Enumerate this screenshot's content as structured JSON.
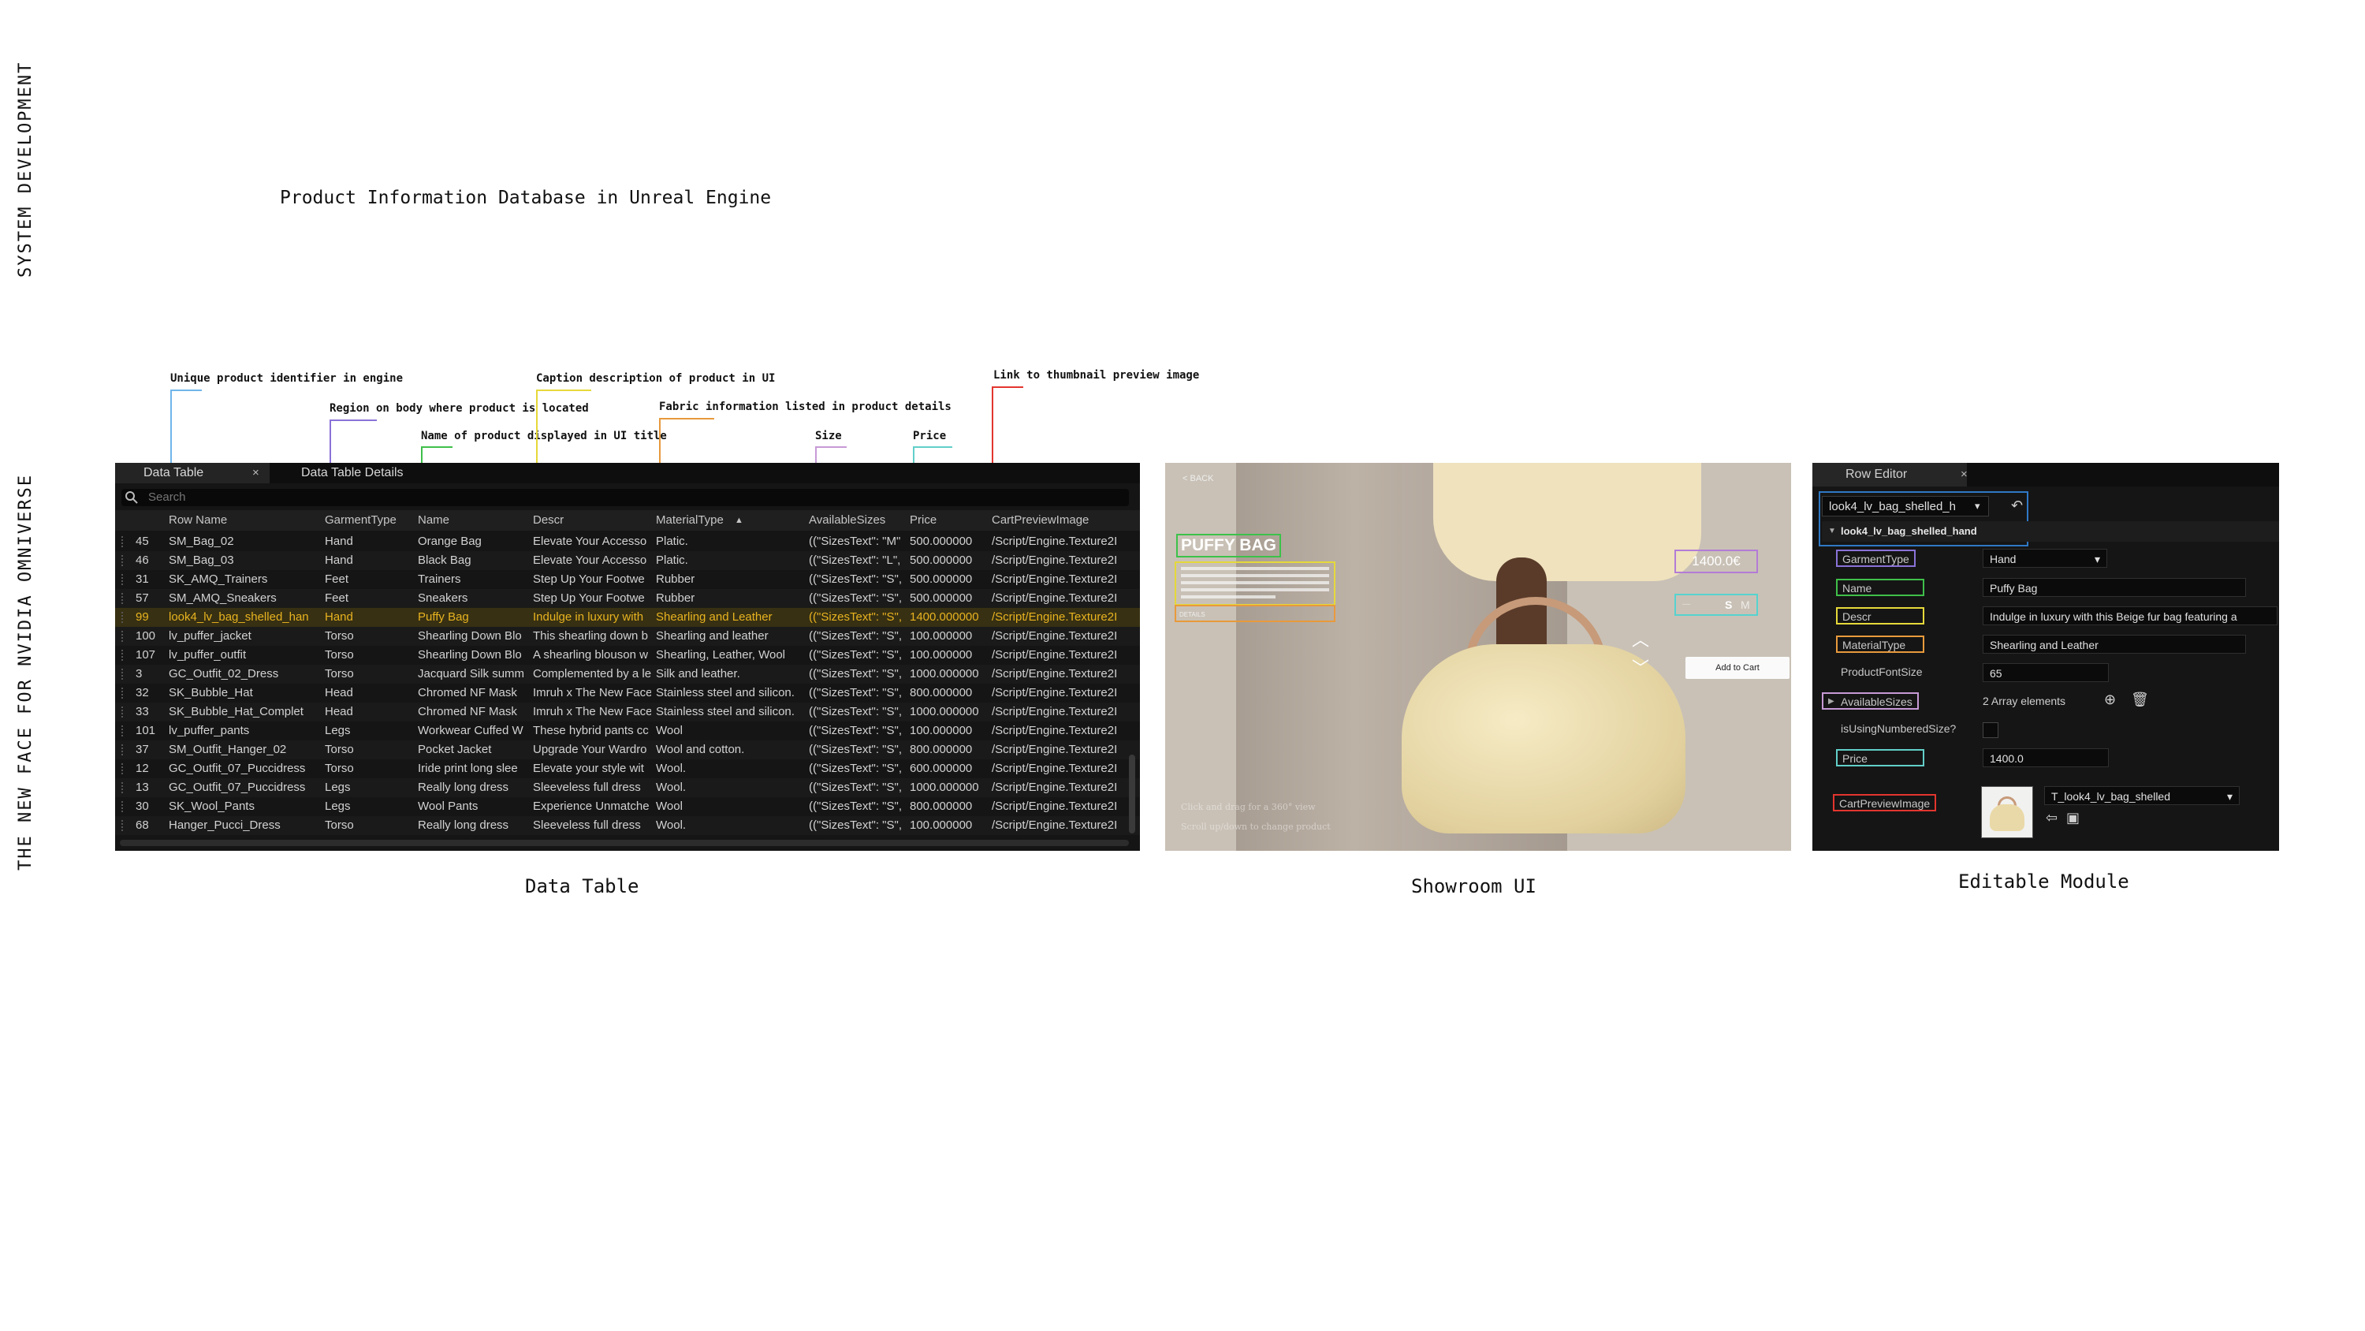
{
  "side_labels": {
    "top": "SYSTEM DEVELOPMENT",
    "bottom": "THE NEW FACE FOR NVIDIA OMNIVERSE"
  },
  "page_title": "Product Information Database in Unreal Engine",
  "colors": {
    "row_name": "#6fb5ea",
    "garment_type": "#8a72d8",
    "name": "#3fbf4a",
    "descr": "#e6d93a",
    "material": "#e89a3c",
    "sizes": "#c79ad6",
    "price": "#62cfc9",
    "cart_preview": "#e2352e",
    "selection": "#e8b320",
    "editor_highlight": "#2f78c4"
  },
  "annotations": {
    "row_name": "Unique product identifier in engine",
    "garment_type": "Region on body where product is located",
    "name": "Name of product displayed in UI title",
    "descr": "Caption description of product in UI",
    "material": "Fabric information listed in product details",
    "sizes": "Size",
    "price": "Price",
    "cart_preview": "Link to thumbnail preview image"
  },
  "data_table": {
    "tab_active": "Data Table",
    "tab_details": "Data Table Details",
    "close_glyph": "×",
    "search_placeholder": "Search",
    "sort_indicator": "▲",
    "columns": [
      "Row Name",
      "GarmentType",
      "Name",
      "Descr",
      "MaterialType",
      "AvailableSizes",
      "Price",
      "CartPreviewImage"
    ],
    "rows": [
      [
        "45",
        "SM_Bag_02",
        "Hand",
        "Orange Bag",
        "Elevate Your Accesso",
        "Platic.",
        "((\"SizesText\": \"M\"",
        "500.000000",
        "/Script/Engine.Texture2I"
      ],
      [
        "46",
        "SM_Bag_03",
        "Hand",
        "Black Bag",
        "Elevate Your Accesso",
        "Platic.",
        "((\"SizesText\": \"L\",",
        "500.000000",
        "/Script/Engine.Texture2I"
      ],
      [
        "31",
        "SK_AMQ_Trainers",
        "Feet",
        "Trainers",
        "Step Up Your Footwe",
        "Rubber",
        "((\"SizesText\": \"S\",",
        "500.000000",
        "/Script/Engine.Texture2I"
      ],
      [
        "57",
        "SM_AMQ_Sneakers",
        "Feet",
        "Sneakers",
        "Step Up Your Footwe",
        "Rubber",
        "((\"SizesText\": \"S\",",
        "500.000000",
        "/Script/Engine.Texture2I"
      ],
      [
        "99",
        "look4_lv_bag_shelled_han",
        "Hand",
        "Puffy Bag",
        "Indulge in luxury with",
        "Shearling and Leather",
        "((\"SizesText\": \"S\",",
        "1400.000000",
        "/Script/Engine.Texture2I"
      ],
      [
        "100",
        "lv_puffer_jacket",
        "Torso",
        "Shearling Down Blo",
        "This shearling down b",
        "Shearling and leather",
        "((\"SizesText\": \"S\",",
        "100.000000",
        "/Script/Engine.Texture2I"
      ],
      [
        "107",
        "lv_puffer_outfit",
        "Torso",
        "Shearling Down Blo",
        "A shearling blouson w",
        "Shearling, Leather, Wool",
        "((\"SizesText\": \"S\",",
        "100.000000",
        "/Script/Engine.Texture2I"
      ],
      [
        "3",
        "GC_Outfit_02_Dress",
        "Torso",
        "Jacquard Silk summ",
        "Complemented by a le",
        "Silk and leather.",
        "((\"SizesText\": \"S\",",
        "1000.000000",
        "/Script/Engine.Texture2I"
      ],
      [
        "32",
        "SK_Bubble_Hat",
        "Head",
        "Chromed NF Mask",
        "Imruh x The New Face",
        "Stainless steel and silicon.",
        "((\"SizesText\": \"S\",",
        "800.000000",
        "/Script/Engine.Texture2I"
      ],
      [
        "33",
        "SK_Bubble_Hat_Complet",
        "Head",
        "Chromed NF Mask",
        "Imruh x The New Face",
        "Stainless steel and silicon.",
        "((\"SizesText\": \"S\",",
        "1000.000000",
        "/Script/Engine.Texture2I"
      ],
      [
        "101",
        "lv_puffer_pants",
        "Legs",
        "Workwear Cuffed W",
        "These hybrid pants cc",
        "Wool",
        "((\"SizesText\": \"S\",",
        "100.000000",
        "/Script/Engine.Texture2I"
      ],
      [
        "37",
        "SM_Outfit_Hanger_02",
        "Torso",
        "Pocket Jacket",
        "Upgrade Your Wardro",
        "Wool and cotton.",
        "((\"SizesText\": \"S\",",
        "800.000000",
        "/Script/Engine.Texture2I"
      ],
      [
        "12",
        "GC_Outfit_07_Puccidress",
        "Torso",
        "Iride print long slee",
        "Elevate your style wit",
        "Wool.",
        "((\"SizesText\": \"S\",",
        "600.000000",
        "/Script/Engine.Texture2I"
      ],
      [
        "13",
        "GC_Outfit_07_Puccidress",
        "Legs",
        "Really long dress",
        "Sleeveless full dress",
        "Wool.",
        "((\"SizesText\": \"S\",",
        "1000.000000",
        "/Script/Engine.Texture2I"
      ],
      [
        "30",
        "SK_Wool_Pants",
        "Legs",
        "Wool Pants",
        "Experience Unmatche",
        "Wool",
        "((\"SizesText\": \"S\",",
        "800.000000",
        "/Script/Engine.Texture2I"
      ],
      [
        "68",
        "Hanger_Pucci_Dress",
        "Torso",
        "Really long dress",
        "Sleeveless full dress",
        "Wool.",
        "((\"SizesText\": \"S\",",
        "100.000000",
        "/Script/Engine.Texture2I"
      ]
    ],
    "selected_row_index": 4,
    "caption": "Data Table"
  },
  "showroom": {
    "back": "< BACK",
    "title": "PUFFY BAG",
    "details_label": "DETAILS",
    "price": "1400.0€",
    "size_selected": "S",
    "size_next": "M",
    "add_to_cart": "Add to Cart",
    "up_glyph": "︿",
    "down_glyph": "﹀",
    "hint1": "Click and drag for a 360° view",
    "hint2": "Scroll up/down to change product",
    "caption": "Showroom UI"
  },
  "row_editor": {
    "tab": "Row Editor",
    "close_glyph": "×",
    "row_select": "look4_lv_bag_shelled_h",
    "section": "look4_lv_bag_shelled_hand",
    "fields": {
      "garment_type_label": "GarmentType",
      "garment_type_value": "Hand",
      "name_label": "Name",
      "name_value": "Puffy Bag",
      "descr_label": "Descr",
      "descr_value": "Indulge in luxury with this Beige fur bag featuring a",
      "material_label": "MaterialType",
      "material_value": "Shearling and Leather",
      "font_size_label": "ProductFontSize",
      "font_size_value": "65",
      "sizes_label": "AvailableSizes",
      "sizes_value": "2 Array elements",
      "numbered_label": "isUsingNumberedSize?",
      "price_label": "Price",
      "price_value": "1400.0",
      "cart_label": "CartPreviewImage",
      "cart_value": "T_look4_lv_bag_shelled"
    },
    "caption": "Editable Module"
  }
}
